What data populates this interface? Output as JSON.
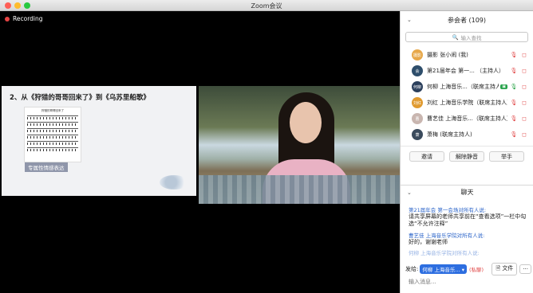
{
  "window": {
    "title": "Zoom会议"
  },
  "recording": {
    "label": "Recording"
  },
  "slide": {
    "title": "2、从《狩猎的哥哥回来了》到《乌苏里船歌》",
    "score_title": "狩猎的哥哥回来了",
    "badge": "专属性情感表达"
  },
  "participants": {
    "header": "参会者 (109)",
    "search_placeholder": "输入查找",
    "list": [
      {
        "avatar_text": "摄影",
        "avatar_color": "#e7a84a",
        "name": "摄影 张小闹 (我)",
        "tag": "",
        "status": "muted"
      },
      {
        "avatar_text": "会",
        "avatar_color": "#2e4e6b",
        "name": "第21届年会 第一... （主持人）",
        "tag": "",
        "status": "muted"
      },
      {
        "avatar_text": "何柳",
        "avatar_color": "#2b3f5c",
        "name": "何柳 上海音乐...（联席主持人）",
        "tag": "▣",
        "status": "on"
      },
      {
        "avatar_text": "刘红",
        "avatar_color": "#e09a2f",
        "name": "刘红 上海音乐学院（联席主持人）",
        "tag": "",
        "status": "muted"
      },
      {
        "avatar_text": "曹",
        "avatar_color": "#c9b6b0",
        "name": "曹艺佳 上海音乐...（联席主持人）",
        "tag": "",
        "status": "muted"
      },
      {
        "avatar_text": "萧",
        "avatar_color": "#3a4a5c",
        "name": "萧梅 (联席主持人)",
        "tag": "",
        "status": "muted"
      }
    ],
    "buttons": {
      "invite": "邀请",
      "unmute": "解除静音",
      "raise_hand": "举手"
    }
  },
  "chat": {
    "header": "聊天",
    "messages": [
      {
        "sender": "第21届年会 第一会场对所有人说:",
        "text": "请共享屏幕的老师共享前在“查看选项”一栏中勾选“不允许注释”"
      },
      {
        "sender": "曹艺佳 上海音乐学院对所有人说:",
        "text": "好的，谢谢老师"
      },
      {
        "sender": "何柳 上海音乐学院对所有人说:",
        "text": ""
      }
    ],
    "send_to_label": "发给:",
    "send_to_value": "何柳 上海音乐...",
    "private_label": "(私聊)",
    "file_button": "文件",
    "more_button": "···",
    "input_placeholder": "输入消息..."
  },
  "colors": {
    "accent": "#2d6ee0",
    "muted_red": "#e04545",
    "recording_red": "#e64444"
  }
}
